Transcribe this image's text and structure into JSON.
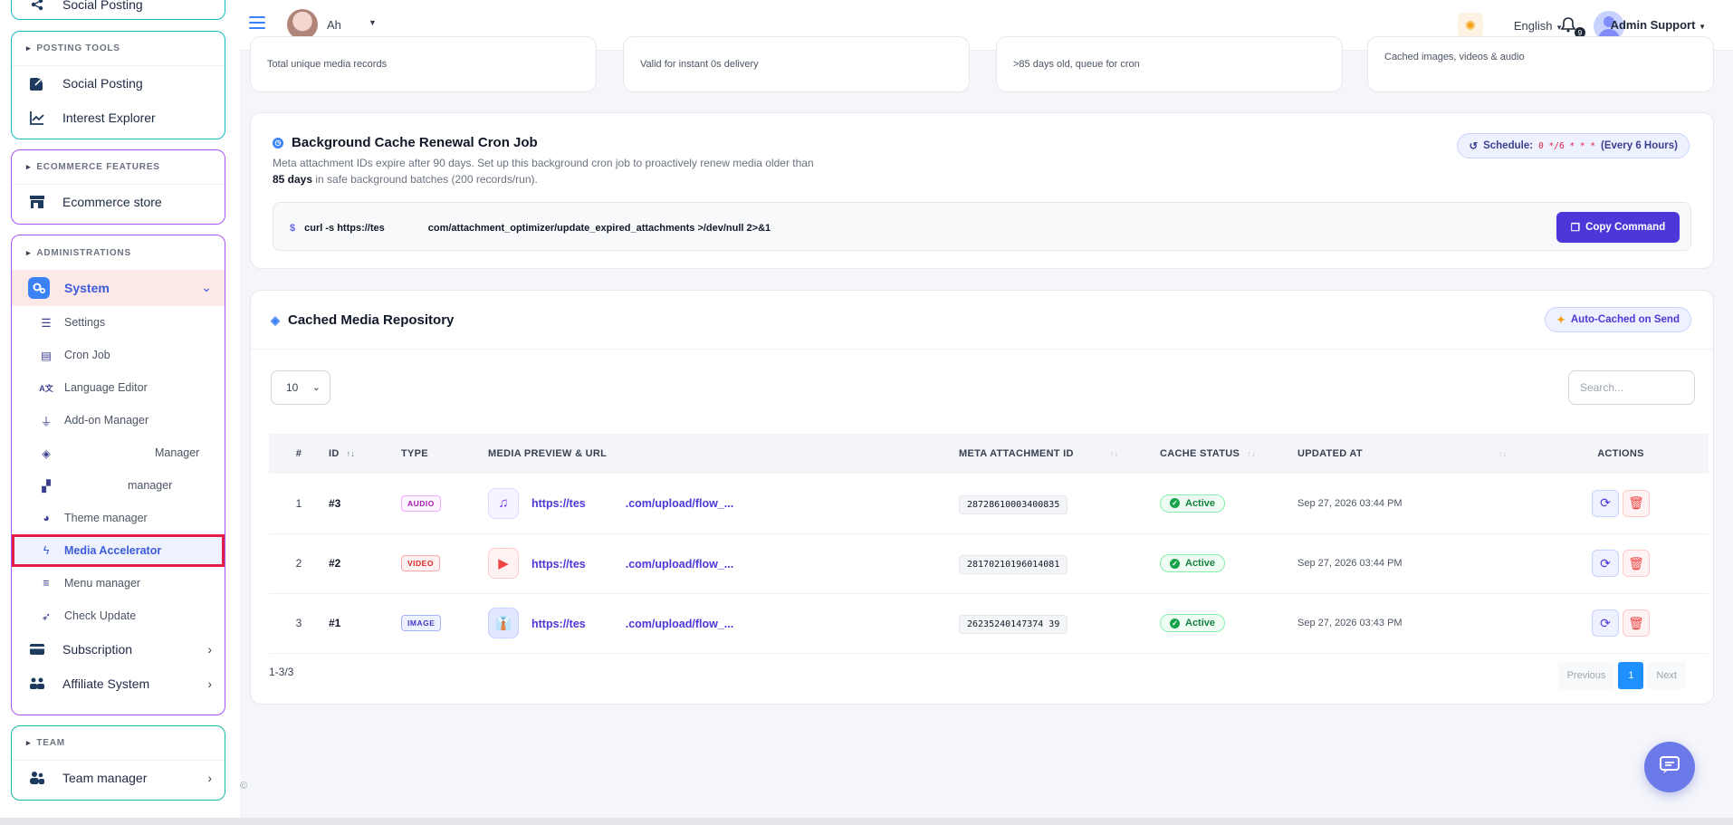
{
  "sidebar": {
    "top_item": "Social Posting",
    "posting_tools": {
      "header": "POSTING TOOLS",
      "items": [
        "Social Posting",
        "Interest Explorer"
      ]
    },
    "ecommerce": {
      "header": "ECOMMERCE FEATURES",
      "items": [
        "Ecommerce store"
      ]
    },
    "administrations": {
      "header": "ADMINISTRATIONS",
      "system": "System",
      "sub_items": [
        "Settings",
        "Cron Job",
        "Language Editor",
        "Add-on Manager",
        "Manager",
        "manager",
        "Theme manager",
        "Media Accelerator",
        "Menu manager",
        "Check Update"
      ],
      "subscription": "Subscription",
      "affiliate": "Affiliate System"
    },
    "team": {
      "header": "TEAM",
      "items": [
        "Team manager"
      ]
    }
  },
  "topbar": {
    "user_name": "Ah",
    "language": "English",
    "notification_count": "9",
    "admin_name": "Admin Support"
  },
  "stats": [
    "Total unique media records",
    "Valid for instant 0s delivery",
    ">85 days old, queue for cron",
    "Cached images, videos & audio"
  ],
  "cron": {
    "title": "Background Cache Renewal Cron Job",
    "desc_line1": "Meta attachment IDs expire after 90 days. Set up this background cron job to proactively renew media older than",
    "desc_bold": "85 days",
    "desc_line2_rest": " in safe background batches (200 records/run).",
    "schedule_label": "Schedule:",
    "schedule_code": "0 */6 * * *",
    "schedule_note": "(Every 6 Hours)",
    "command_start": "curl -s https://tes",
    "command_end": "com/attachment_optimizer/update_expired_attachments >/dev/null 2>&1",
    "copy_label": "Copy Command"
  },
  "repo": {
    "title": "Cached Media Repository",
    "auto_badge": "Auto-Cached on Send",
    "page_size": "10",
    "search_placeholder": "Search...",
    "columns": [
      "#",
      "ID",
      "TYPE",
      "MEDIA PREVIEW & URL",
      "META ATTACHMENT ID",
      "CACHE STATUS",
      "UPDATED AT",
      "ACTIONS"
    ],
    "rows": [
      {
        "n": "1",
        "id": "#3",
        "type": "AUDIO",
        "url_start": "https://tes",
        "url_end": ".com/upload/flow_...",
        "meta_id": "28728610003400835",
        "status": "Active",
        "updated": "Sep 27, 2026 03:44 PM"
      },
      {
        "n": "2",
        "id": "#2",
        "type": "VIDEO",
        "url_start": "https://tes",
        "url_end": ".com/upload/flow_...",
        "meta_id": "28170210196014081",
        "status": "Active",
        "updated": "Sep 27, 2026 03:44 PM"
      },
      {
        "n": "3",
        "id": "#1",
        "type": "IMAGE",
        "url_start": "https://tes",
        "url_end": ".com/upload/flow_...",
        "meta_id": "26235240147374 39",
        "status": "Active",
        "updated": "Sep 27, 2026 03:43 PM"
      }
    ],
    "range": "1-3/3",
    "prev": "Previous",
    "current_page": "1",
    "next": "Next"
  },
  "footer": "©",
  "colors": {
    "accent": "#4c38d9",
    "highlight_border": "#e11d48",
    "active_green": "#16a34a"
  }
}
